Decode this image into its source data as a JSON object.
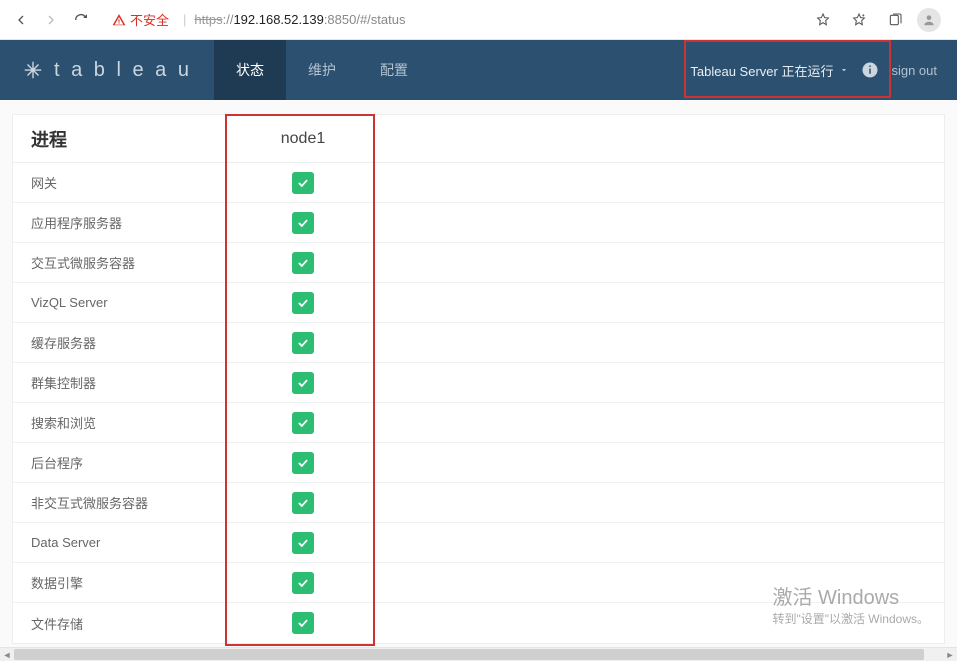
{
  "browser": {
    "insecure_label": "不安全",
    "url_protocol": "https",
    "url_sep": "://",
    "url_host": "192.168.52.139",
    "url_port_path": ":8850/#/status"
  },
  "header": {
    "brand": "t a b l e a u",
    "tabs": [
      {
        "label": "状态",
        "active": true
      },
      {
        "label": "维护",
        "active": false
      },
      {
        "label": "配置",
        "active": false
      }
    ],
    "server_status_label": "Tableau Server 正在运行",
    "signout_label": "sign out"
  },
  "table": {
    "col_process": "进程",
    "col_node": "node1",
    "rows": [
      {
        "name": "网关",
        "status": "ok"
      },
      {
        "name": "应用程序服务器",
        "status": "ok"
      },
      {
        "name": "交互式微服务容器",
        "status": "ok"
      },
      {
        "name": "VizQL Server",
        "status": "ok"
      },
      {
        "name": "缓存服务器",
        "status": "ok"
      },
      {
        "name": "群集控制器",
        "status": "ok"
      },
      {
        "name": "搜索和浏览",
        "status": "ok"
      },
      {
        "name": "后台程序",
        "status": "ok"
      },
      {
        "name": "非交互式微服务容器",
        "status": "ok"
      },
      {
        "name": "Data Server",
        "status": "ok"
      },
      {
        "name": "数据引擎",
        "status": "ok"
      },
      {
        "name": "文件存储",
        "status": "ok"
      }
    ]
  },
  "watermark": {
    "line1": "激活 Windows",
    "line2": "转到\"设置\"以激活 Windows。"
  },
  "colors": {
    "accent": "#2c5070",
    "ok": "#2dbd72",
    "highlight": "#c33"
  }
}
